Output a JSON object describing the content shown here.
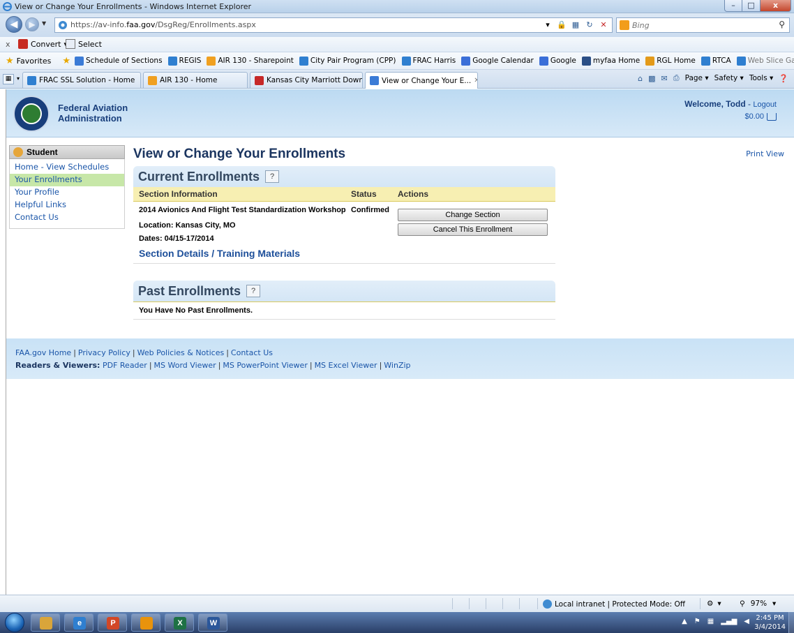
{
  "window": {
    "title": "View or Change Your Enrollments - Windows Internet Explorer",
    "min": "–",
    "max": "□",
    "close": "x"
  },
  "address": {
    "url_prefix": "https://av-info.",
    "url_domain": "faa.gov",
    "url_path": "/DsgReg/Enrollments.aspx",
    "search_placeholder": "Bing"
  },
  "toolbar": {
    "close": "x",
    "convert": "Convert",
    "select": "Select"
  },
  "favorites": {
    "label": "Favorites",
    "items": [
      {
        "label": "Schedule of Sections",
        "color": "#3b7bd6"
      },
      {
        "label": "REGIS",
        "color": "#2f7fd0"
      },
      {
        "label": "AIR 130 - Sharepoint",
        "color": "#f0a020"
      },
      {
        "label": "City Pair Program (CPP)",
        "color": "#2f7fd0"
      },
      {
        "label": "FRAC Harris",
        "color": "#2f7fd0"
      },
      {
        "label": "Google Calendar",
        "color": "#3b6fd8"
      },
      {
        "label": "Google",
        "color": "#3b6fd8"
      },
      {
        "label": "myfaa Home",
        "color": "#2b4f86"
      },
      {
        "label": "RGL Home",
        "color": "#e39a1a"
      },
      {
        "label": "RTCA",
        "color": "#2f7fd0"
      },
      {
        "label": "Web Slice Gallery",
        "color": "#2f7fd0"
      }
    ]
  },
  "tabs": [
    {
      "label": "FRAC SSL Solution - Home",
      "color": "#2f7fd0"
    },
    {
      "label": "AIR 130 - Home",
      "color": "#f0a020"
    },
    {
      "label": "Kansas City Marriott Down...",
      "color": "#c62828"
    },
    {
      "label": "View or Change Your E...",
      "color": "#3b7bd6"
    }
  ],
  "command_bar": {
    "page": "Page",
    "safety": "Safety",
    "tools": "Tools"
  },
  "site": {
    "agency_line1": "Federal Aviation",
    "agency_line2": "Administration",
    "welcome": "Welcome, Todd",
    "logout": "Logout",
    "cart_total": "$0.00"
  },
  "sidebar": {
    "heading": "Student",
    "items": [
      {
        "label": "Home - View Schedules",
        "active": false
      },
      {
        "label": "Your Enrollments",
        "active": true
      },
      {
        "label": "Your Profile",
        "active": false
      },
      {
        "label": "Helpful Links",
        "active": false
      },
      {
        "label": "Contact Us",
        "active": false
      }
    ]
  },
  "main": {
    "title": "View or Change Your Enrollments",
    "print_view": "Print View",
    "current": {
      "heading": "Current Enrollments",
      "help": "?",
      "columns": [
        "Section Information",
        "Status",
        "Actions"
      ],
      "rows": [
        {
          "course": "2014 Avionics And Flight Test Standardization Workshop",
          "location": "Location: Kansas City, MO",
          "dates": "Dates: 04/15-17/2014",
          "details_link": "Section Details / Training Materials",
          "status": "Confirmed",
          "actions": [
            "Change Section",
            "Cancel This Enrollment"
          ]
        }
      ]
    },
    "past": {
      "heading": "Past Enrollments",
      "help": "?",
      "empty_text": "You Have No Past Enrollments."
    }
  },
  "footer": {
    "links": [
      "FAA.gov Home",
      "Privacy Policy",
      "Web Policies & Notices",
      "Contact Us"
    ],
    "readers_label": "Readers & Viewers:",
    "readers": [
      "PDF Reader",
      "MS Word Viewer",
      "MS PowerPoint Viewer",
      "MS Excel Viewer",
      "WinZip"
    ]
  },
  "statusbar": {
    "zone": "Local intranet | Protected Mode: Off",
    "zoom": "97%"
  },
  "taskbar": {
    "apps": [
      {
        "name": "explorer",
        "color": "#d9a53a",
        "glyph": ""
      },
      {
        "name": "internet-explorer",
        "color": "#2f7fd0",
        "glyph": "e"
      },
      {
        "name": "powerpoint",
        "color": "#d24726",
        "glyph": "P"
      },
      {
        "name": "app-orange",
        "color": "#e8930c",
        "glyph": ""
      },
      {
        "name": "excel",
        "color": "#1e7145",
        "glyph": "X"
      },
      {
        "name": "word",
        "color": "#2b579a",
        "glyph": "W"
      }
    ],
    "time": "2:45 PM",
    "date": "3/4/2014"
  }
}
